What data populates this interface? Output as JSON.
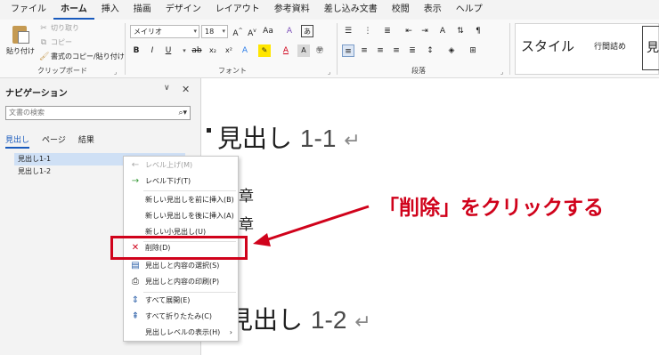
{
  "menubar": {
    "tabs": [
      "ファイル",
      "ホーム",
      "挿入",
      "描画",
      "デザイン",
      "レイアウト",
      "参考資料",
      "差し込み文書",
      "校閲",
      "表示",
      "ヘルプ"
    ],
    "active_index": 1
  },
  "ribbon": {
    "clipboard": {
      "paste": "貼り付け",
      "cut": "切り取り",
      "copy": "コピー",
      "format_painter": "書式のコピー/貼り付け",
      "group_label": "クリップボード"
    },
    "font": {
      "font_name": "メイリオ",
      "font_size": "18",
      "group_label": "フォント"
    },
    "paragraph": {
      "group_label": "段落"
    },
    "styles": {
      "style_label": "スタイル",
      "spacing_label": "行間詰め",
      "heading_preview": "見出"
    }
  },
  "nav": {
    "title": "ナビゲーション",
    "search_placeholder": "文書の検索",
    "tabs": [
      "見出し",
      "ページ",
      "結果"
    ],
    "headings": [
      "見出し1-1",
      "見出し1-2"
    ]
  },
  "document": {
    "heading1": "見出し",
    "heading1_num": "1-1",
    "line1": "章",
    "line2": "章",
    "heading2": "見出し",
    "heading2_num": "1-2",
    "para_mark": "↵"
  },
  "context_menu": {
    "items": [
      {
        "label": "レベル上げ(M)",
        "icon": "arrow-left-icon"
      },
      {
        "label": "レベル下げ(T)",
        "icon": "arrow-right-icon"
      },
      {
        "label": "新しい見出しを前に挿入(B)",
        "icon": ""
      },
      {
        "label": "新しい見出しを後に挿入(A)",
        "icon": ""
      },
      {
        "label": "新しい小見出し(U)",
        "icon": ""
      },
      {
        "label": "削除(D)",
        "icon": "delete-x-icon"
      },
      {
        "label": "見出しと内容の選択(S)",
        "icon": "select-content-icon"
      },
      {
        "label": "見出しと内容の印刷(P)",
        "icon": "print-icon"
      },
      {
        "label": "すべて展開(E)",
        "icon": "expand-all-icon"
      },
      {
        "label": "すべて折りたたみ(C)",
        "icon": "collapse-all-icon"
      },
      {
        "label": "見出しレベルの表示(H)",
        "icon": ""
      }
    ]
  },
  "annotation": {
    "callout": "「削除」をクリックする",
    "color": "#d0021b"
  },
  "colors": {
    "accent": "#185abd",
    "selection": "#cfe0f5"
  }
}
